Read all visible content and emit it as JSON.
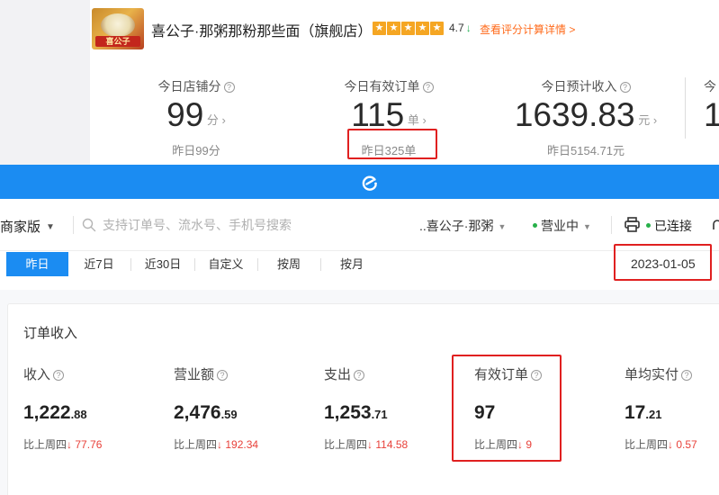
{
  "store": {
    "name": "喜公子·那粥那粉那些面（旗舰店）",
    "logo_text": "喜公子",
    "rating": "4.7",
    "rating_trend": "↓",
    "rating_link": "查看评分计算详情 >",
    "star_count": 5
  },
  "today_metrics": [
    {
      "label": "今日店铺分",
      "value": "99",
      "unit": "分",
      "prev": "昨日99分"
    },
    {
      "label": "今日有效订单",
      "value": "115",
      "unit": "单",
      "prev": "昨日325单"
    },
    {
      "label": "今日预计收入",
      "value": "1639.83",
      "unit": "元",
      "prev": "昨日5154.71元"
    },
    {
      "label": "今",
      "value": "1"
    }
  ],
  "toolbar": {
    "edition": "商家版",
    "search_placeholder": "支持订单号、流水号、手机号搜索",
    "store_select": "..喜公子·那粥",
    "status": "营业中",
    "printer_status": "已连接"
  },
  "date_tabs": [
    "昨日",
    "近7日",
    "近30日",
    "自定义",
    "按周",
    "按月"
  ],
  "active_tab": "昨日",
  "selected_date": "2023-01-05",
  "order_income": {
    "title": "订单收入",
    "stats": [
      {
        "label": "收入",
        "int": "1,222",
        "dec": ".88",
        "cmp_label": "比上周四",
        "cmp_arrow": "↓",
        "cmp_value": "77.76"
      },
      {
        "label": "营业额",
        "int": "2,476",
        "dec": ".59",
        "cmp_label": "比上周四",
        "cmp_arrow": "↓",
        "cmp_value": "192.34"
      },
      {
        "label": "支出",
        "int": "1,253",
        "dec": ".71",
        "cmp_label": "比上周四",
        "cmp_arrow": "↓",
        "cmp_value": "114.58"
      },
      {
        "label": "有效订单",
        "int": "97",
        "dec": "",
        "cmp_label": "比上周四",
        "cmp_arrow": "↓",
        "cmp_value": "9"
      },
      {
        "label": "单均实付",
        "int": "17",
        "dec": ".21",
        "cmp_label": "比上周四",
        "cmp_arrow": "↓",
        "cmp_value": "0.57"
      }
    ]
  },
  "colors": {
    "brand_blue": "#1b8cf2",
    "highlight_red": "#e02020",
    "star_orange": "#f5a623",
    "link_orange": "#ff6a1a",
    "decrease_red": "#e8413a",
    "status_green": "#27b04a"
  }
}
